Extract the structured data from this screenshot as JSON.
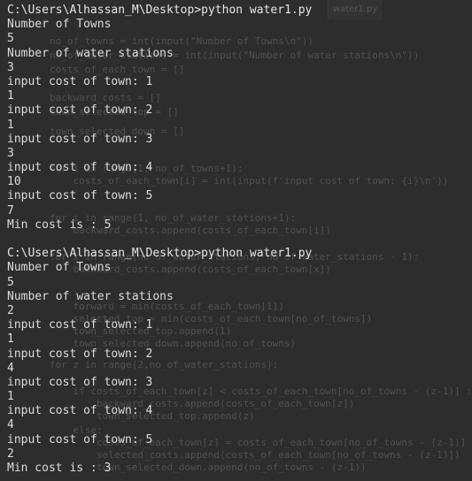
{
  "background_code": {
    "tab_label": "water1.py",
    "lines": [
      "no_of_towns = int(input(\"Number of Towns\\n\"))",
      "no_of_water_stations = int(input(\"Number of water stations\\n\"))",
      "costs_of_each_town = []",
      "backward_costs = []",
      "town_selected_top = []",
      "town_selected_down = []",
      "for i in range(1, no_of_towns+1):",
      "    costs_of_each_town[i] = int(input(f'input cost of town: {i}\\n'))",
      "for i in range(1, no_of_water_stations+1):",
      "    backward_costs.append(costs_of_each_town[i])",
      "for x in range(no_of_water_stations, no_of_water_stations - 1):",
      "    backward_costs.append(costs_of_each_town[x])",
      "    forward = min(costs_of_each_town[1])",
      "    selected_top = min(costs_of_each_town[no_of_towns])",
      "    town_selected_top.append(1)",
      "    town_selected_down.append(no_of_towns)",
      "for z in range(2,no_of_water_stations):",
      "    if costs_of_each_town[z] < costs_of_each_town[no_of_towns - (z-1)] :",
      "        backward_costs.append(costs_of_each_town[z])",
      "        town_selected_top.append(z)",
      "    else:",
      "        costs_of_each_town[z] = costs_of_each_town[no_of_towns - (z-1)]",
      "        selected_costs.append(costs_of_each_town[no_of_towns - (z-1)])",
      "        town_selected_down.append(no_of_towns - (z-1))"
    ]
  },
  "terminal": {
    "lines": [
      "C:\\Users\\Alhassan_M\\Desktop>python water1.py",
      "Number of Towns",
      "5",
      "Number of water stations",
      "3",
      "input cost of town: 1",
      "1",
      "input cost of town: 2",
      "1",
      "input cost of town: 3",
      "3",
      "input cost of town: 4",
      "10",
      "input cost of town: 5",
      "7",
      "Min cost is : 5",
      "",
      "C:\\Users\\Alhassan_M\\Desktop>python water1.py",
      "Number of Towns",
      "5",
      "Number of water stations",
      "2",
      "input cost of town: 1",
      "1",
      "input cost of town: 2",
      "4",
      "input cost of town: 3",
      "1",
      "input cost of town: 4",
      "4",
      "input cost of town: 5",
      "2",
      "Min cost is : 3"
    ]
  },
  "colors": {
    "terminal_text": "#dcdcdc",
    "background": "#2d2d2d",
    "ghost_code": "#505050"
  }
}
